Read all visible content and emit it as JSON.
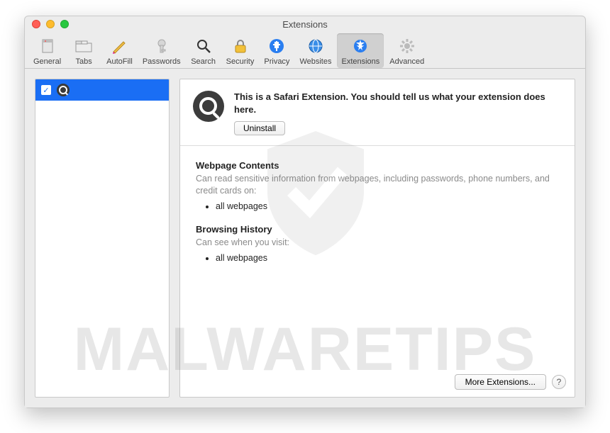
{
  "window": {
    "title": "Extensions"
  },
  "toolbar": {
    "items": [
      {
        "label": "General"
      },
      {
        "label": "Tabs"
      },
      {
        "label": "AutoFill"
      },
      {
        "label": "Passwords"
      },
      {
        "label": "Search"
      },
      {
        "label": "Security"
      },
      {
        "label": "Privacy"
      },
      {
        "label": "Websites"
      },
      {
        "label": "Extensions"
      },
      {
        "label": "Advanced"
      }
    ],
    "selected_index": 8
  },
  "sidebar": {
    "items": [
      {
        "checked": true,
        "icon": "search-icon"
      }
    ]
  },
  "extension": {
    "description": "This is a Safari Extension. You should tell us what your extension does here.",
    "uninstall_label": "Uninstall",
    "sections": [
      {
        "title": "Webpage Contents",
        "subtitle": "Can read sensitive information from webpages, including passwords, phone numbers, and credit cards on:",
        "items": [
          "all webpages"
        ]
      },
      {
        "title": "Browsing History",
        "subtitle": "Can see when you visit:",
        "items": [
          "all webpages"
        ]
      }
    ]
  },
  "footer": {
    "more_label": "More Extensions...",
    "help_label": "?"
  },
  "watermark": "MALWARETIPS"
}
